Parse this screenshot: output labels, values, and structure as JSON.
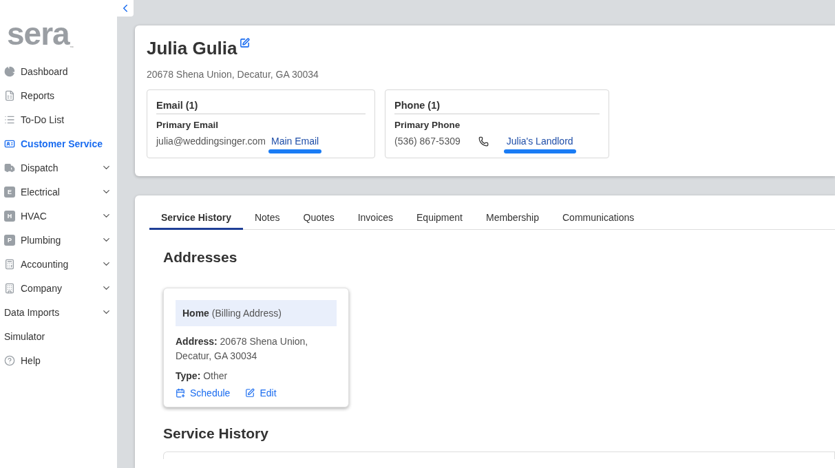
{
  "logo": {
    "text": "sera",
    "mark": "™"
  },
  "sidebar": {
    "items": [
      {
        "label": "Dashboard",
        "kind": "icon",
        "selected": false,
        "expandable": false
      },
      {
        "label": "Reports",
        "kind": "icon",
        "selected": false,
        "expandable": false
      },
      {
        "label": "To-Do List",
        "kind": "icon",
        "selected": false,
        "expandable": false
      },
      {
        "label": "Customer Service",
        "kind": "icon",
        "selected": true,
        "expandable": false
      },
      {
        "label": "Dispatch",
        "kind": "icon",
        "selected": false,
        "expandable": true
      },
      {
        "label": "Electrical",
        "kind": "badge",
        "badge": "E",
        "selected": false,
        "expandable": true
      },
      {
        "label": "HVAC",
        "kind": "badge",
        "badge": "H",
        "selected": false,
        "expandable": true
      },
      {
        "label": "Plumbing",
        "kind": "badge",
        "badge": "P",
        "selected": false,
        "expandable": true
      },
      {
        "label": "Accounting",
        "kind": "icon",
        "selected": false,
        "expandable": true
      },
      {
        "label": "Company",
        "kind": "icon",
        "selected": false,
        "expandable": true
      },
      {
        "label": "Data Imports",
        "kind": "plain",
        "selected": false,
        "expandable": true
      },
      {
        "label": "Simulator",
        "kind": "plain",
        "selected": false,
        "expandable": false
      },
      {
        "label": "Help",
        "kind": "icon",
        "selected": false,
        "expandable": false
      }
    ]
  },
  "customer": {
    "name": "Julia Gulia",
    "address": "20678 Shena Union, Decatur, GA 30034",
    "contacts": [
      {
        "kind": "email",
        "title": "Email (1)",
        "label": "Primary Email",
        "value": "julia@weddingsinger.com",
        "link": "Main Email"
      },
      {
        "kind": "phone",
        "title": "Phone (1)",
        "label": "Primary Phone",
        "value": "(536) 867-5309",
        "link": "Julia's Landlord"
      }
    ]
  },
  "tabs": [
    {
      "label": "Service History",
      "selected": true
    },
    {
      "label": "Notes",
      "selected": false
    },
    {
      "label": "Quotes",
      "selected": false
    },
    {
      "label": "Invoices",
      "selected": false
    },
    {
      "label": "Equipment",
      "selected": false
    },
    {
      "label": "Membership",
      "selected": false
    },
    {
      "label": "Communications",
      "selected": false
    }
  ],
  "addresses": {
    "heading": "Addresses",
    "cards": [
      {
        "name": "Home",
        "tag": "(Billing Address)",
        "address_label": "Address:",
        "address": "20678 Shena Union, Decatur, GA 30034",
        "type_label": "Type:",
        "type": "Other",
        "actions": [
          "Schedule",
          "Edit"
        ]
      }
    ]
  },
  "service_history": {
    "heading": "Service History"
  }
}
